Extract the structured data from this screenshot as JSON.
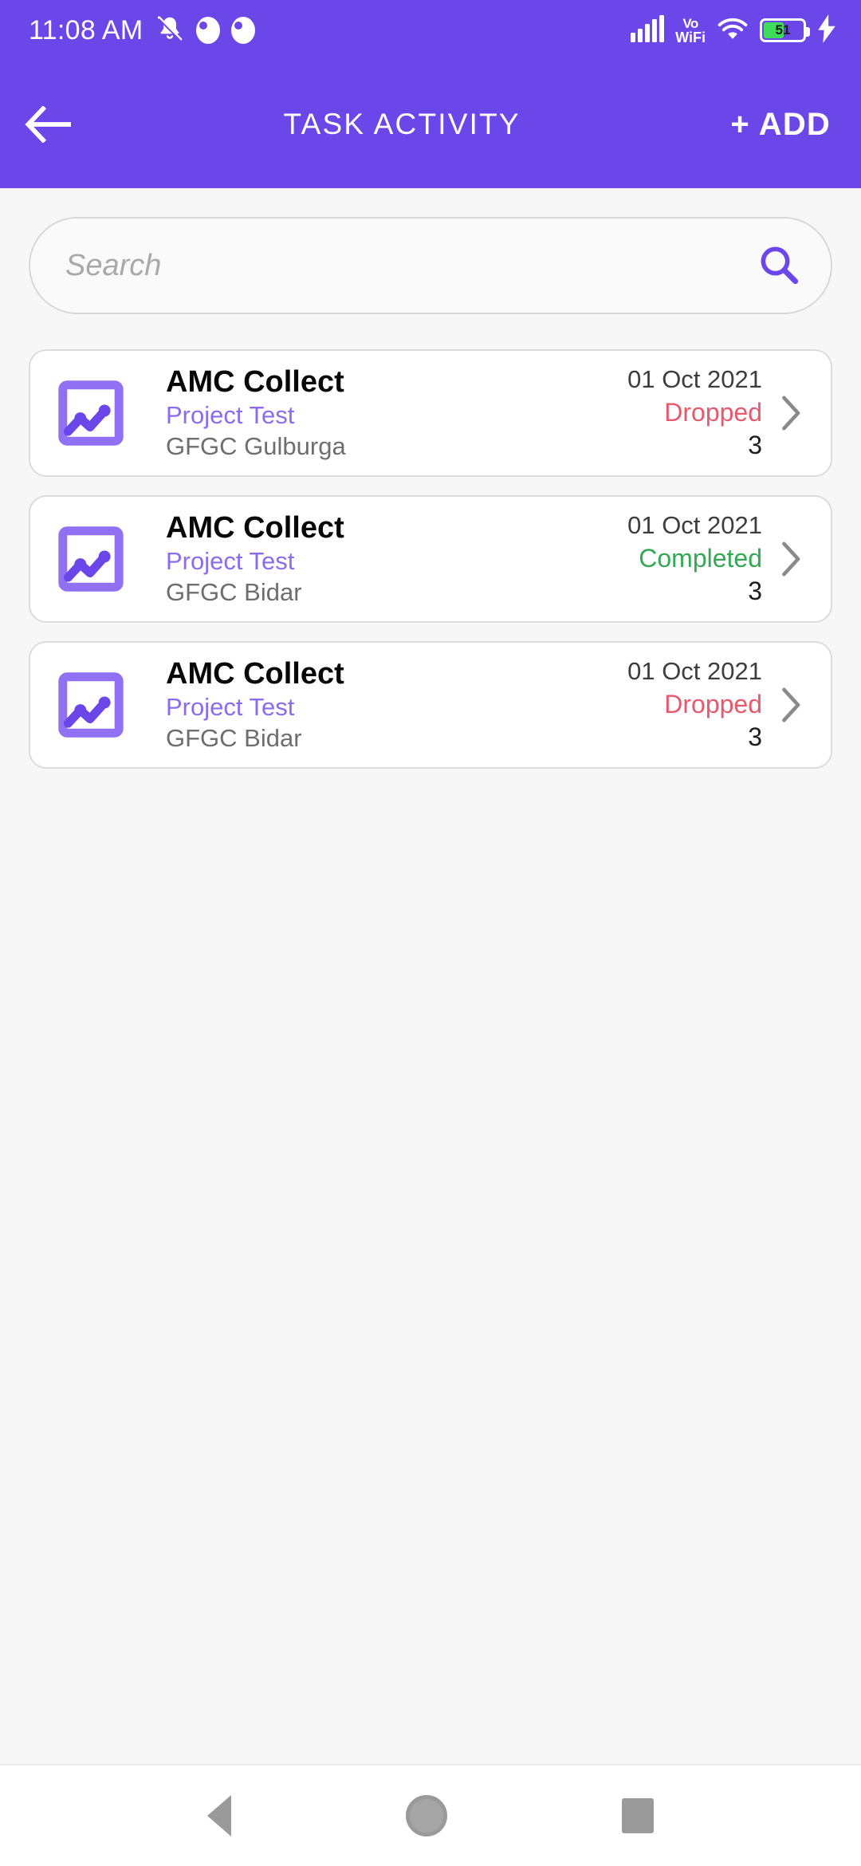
{
  "statusbar": {
    "time": "11:08 AM",
    "icons": [
      "bell-muted-icon",
      "app-badge-icon",
      "app-badge-icon"
    ],
    "network_label_top": "Vo",
    "network_label_bottom": "WiFi",
    "battery_percent": "51",
    "battery_charging": true
  },
  "appbar": {
    "back_label": "back-arrow",
    "title": "TASK ACTIVITY",
    "add_label": "+ ADD",
    "bg_color": "#6B46E8"
  },
  "search": {
    "placeholder": "Search",
    "value": "",
    "icon": "search-icon",
    "icon_color": "#6B46E8"
  },
  "colors": {
    "accent": "#6B46E8",
    "project_text": "#8B6CF0",
    "status_dropped": "#E8596E",
    "status_completed": "#34A853",
    "location_text": "#6E6E6E"
  },
  "tasks": [
    {
      "title": "AMC Collect",
      "project": "Project Test",
      "location": "GFGC Gulburga",
      "date": "01 Oct 2021",
      "status": "Dropped",
      "status_color": "#E8596E",
      "count": "3"
    },
    {
      "title": "AMC Collect",
      "project": "Project Test",
      "location": "GFGC Bidar",
      "date": "01 Oct 2021",
      "status": "Completed",
      "status_color": "#34A853",
      "count": "3"
    },
    {
      "title": "AMC Collect",
      "project": "Project Test",
      "location": "GFGC Bidar",
      "date": "01 Oct 2021",
      "status": "Dropped",
      "status_color": "#E8596E",
      "count": "3"
    }
  ],
  "navbar": {
    "back": "nav-back-icon",
    "home": "nav-home-icon",
    "recents": "nav-recents-icon"
  }
}
